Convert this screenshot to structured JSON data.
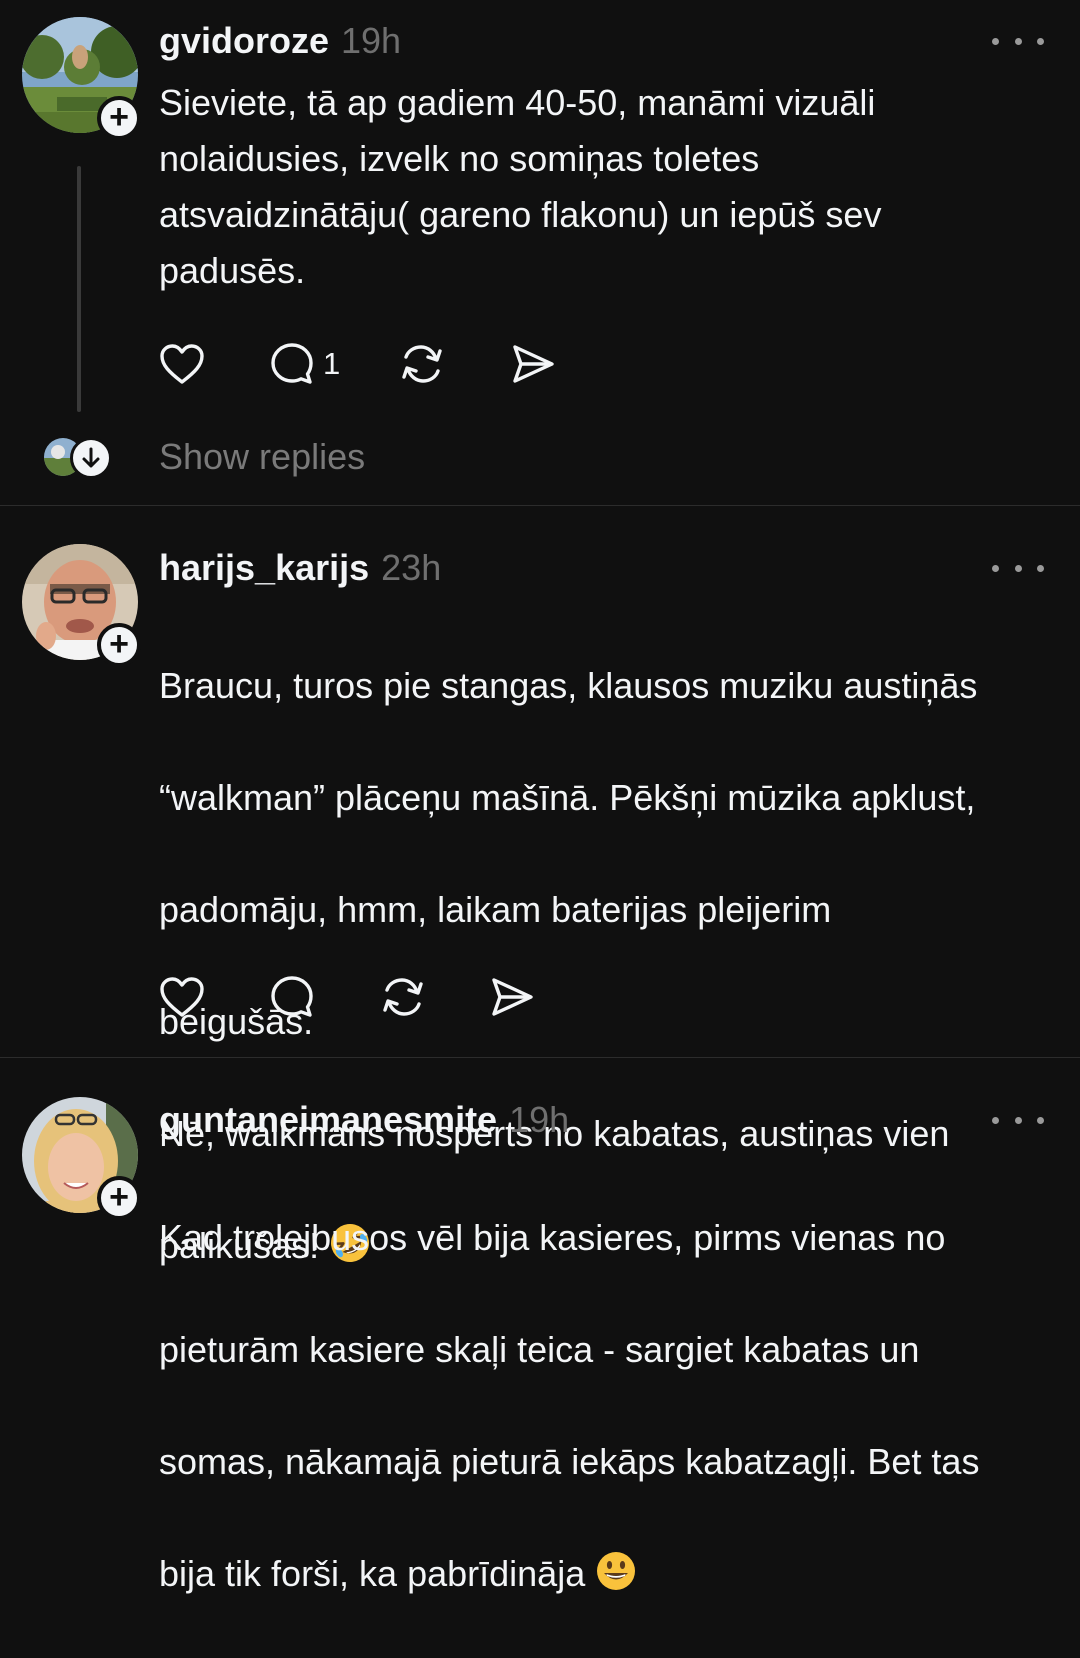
{
  "posts": [
    {
      "username": "gvidoroze",
      "time": "19h",
      "text": "Sieviete, tā ap gadiem 40-50,  manāmi vizuāli\nnolaidusies, izvelk no somiņas toletes\natsvaidzinātāju( gareno flakonu) un iepūš sev\npadusēs.",
      "reply_count": "1",
      "show_replies_label": "Show replies"
    },
    {
      "username": "harijs_karijs",
      "time": "23h",
      "text_lines": [
        "Braucu, turos pie stangas, klausos muziku austiņās",
        "“walkman” plāceņu mašīnā. Pēkšņi mūzika apklust,",
        "padomāju, hmm, laikam baterijas pleijerim",
        "beigušās.",
        "Nē, walkmans nosperts no kabatas, austiņas vien",
        "palikušas!"
      ],
      "emoji": "rolling-on-floor-laughing"
    },
    {
      "username": "guntaneimanesmite",
      "time": "19h",
      "text_lines": [
        "Kad trolejbusos vēl bija kasieres, pirms vienas no",
        "pieturām kasiere skaļi teica - sargiet kabatas un",
        "somas, nākamajā pieturā iekāps kabatzagļi. Bet tas",
        "bija tik forši, ka pabrīdināja"
      ],
      "emoji": "grinning-face"
    }
  ],
  "icons": {
    "like": "heart-icon",
    "comment": "comment-bubble-icon",
    "repost": "repost-arrows-icon",
    "share": "send-paper-plane-icon",
    "more": "more-dots-icon",
    "follow": "plus-icon",
    "expand": "arrow-down-icon"
  },
  "colors": {
    "background": "#101010",
    "text": "#f3f5f7",
    "secondary_text": "#6f6f6f",
    "divider": "#2c2c2c"
  }
}
